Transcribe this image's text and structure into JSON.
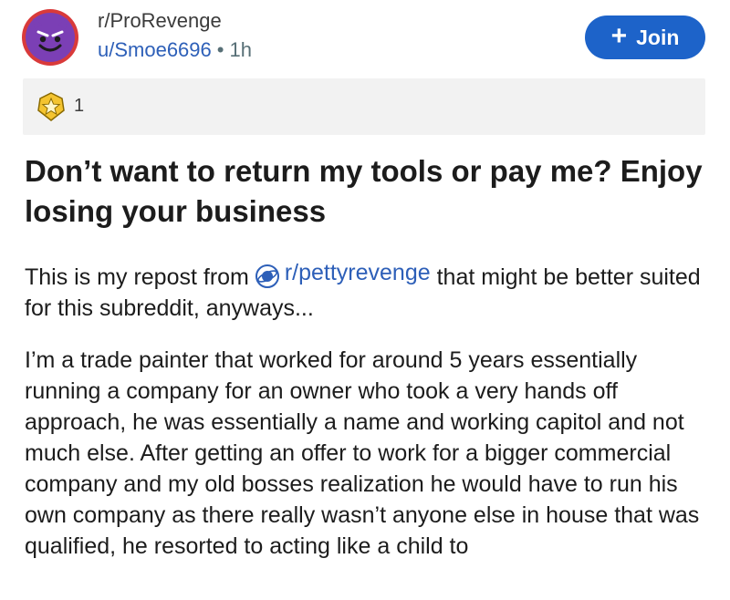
{
  "post": {
    "subreddit": "r/ProRevenge",
    "author": "u/Smoe6696",
    "separator": "•",
    "time_ago": "1h",
    "join_label": "Join",
    "join_icon": "+",
    "award_count": "1",
    "title": "Don’t want to return my tools or pay me? Enjoy losing your business",
    "body": {
      "p1_prefix": "This is my repost from",
      "p1_link": "r/pettyrevenge",
      "p1_suffix": "that might be better suited for this subreddit, anyways...",
      "p2": "I’m a trade painter that worked for around 5 years essentially running a company for an owner who took a very hands off approach, he was essentially a name and working capitol and not much else. After getting an offer to work for a bigger commercial company and my old bosses realization he would have to run his own company as there really wasn’t anyone else in house that was qualified, he resorted to acting like a child to"
    }
  },
  "colors": {
    "join_button": "#1d63c9",
    "link": "#2d5fb8",
    "award_bar": "#f2f2f2",
    "avatar_ring": "#d93a3a",
    "avatar_face": "#7b3fb5"
  },
  "icons": {
    "avatar": "devil-face-icon",
    "award": "gold-star-award-icon",
    "subreddit_chip": "planet-icon"
  }
}
